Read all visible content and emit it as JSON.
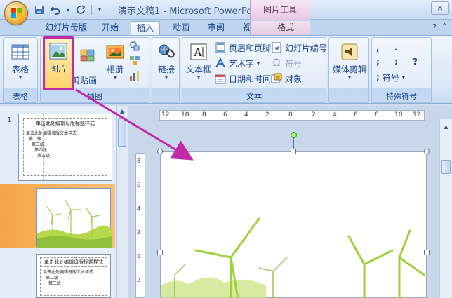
{
  "titlebar": {
    "title": "演示文稿1 - Microsoft PowerPoint",
    "context_tab": "图片工具",
    "qat": [
      "save-icon",
      "undo-icon",
      "redo-icon"
    ]
  },
  "tabs": [
    {
      "label": "幻灯片母版"
    },
    {
      "label": "开始"
    },
    {
      "label": "插入"
    },
    {
      "label": "动画"
    },
    {
      "label": "审阅"
    },
    {
      "label": "视图"
    },
    {
      "label": "格式"
    }
  ],
  "ribbon": {
    "groups": {
      "table": {
        "label": "表格",
        "button": "表格"
      },
      "illustrations": {
        "label": "插图",
        "picture": "图片",
        "clipart": "剪贴画",
        "album": "相册"
      },
      "links": {
        "button": "链接"
      },
      "text": {
        "label": "文本",
        "textbox": "文本框",
        "header_footer": "页眉和页脚",
        "wordart": "艺术字",
        "datetime": "日期和时间",
        "slide_number": "幻灯片编号",
        "symbol": "符号",
        "object": "对象"
      },
      "media": {
        "button": "媒体剪辑"
      },
      "special": {
        "label": "特殊符号",
        "symbols": [
          ",",
          ".",
          ":",
          "?",
          ";",
          ";"
        ],
        "button": "符号"
      }
    }
  },
  "thumbnails": {
    "slide_number": "1",
    "master_title": "单击此处编辑母版标题样式",
    "master_body": "单击此处编辑母版文本样式",
    "levels": [
      "第二级",
      "第三级",
      "第四级",
      "第五级"
    ]
  },
  "ruler": {
    "h_marks": [
      "12",
      "10",
      "8",
      "6",
      "4",
      "2",
      "0",
      "2",
      "4",
      "6",
      "8",
      "10",
      "12"
    ],
    "v_marks": [
      "8",
      "6",
      "4",
      "2",
      "0",
      "2"
    ]
  },
  "colors": {
    "highlight": "#c02ba9",
    "arrow": "#c02ba9",
    "selection": "#f5a548"
  }
}
